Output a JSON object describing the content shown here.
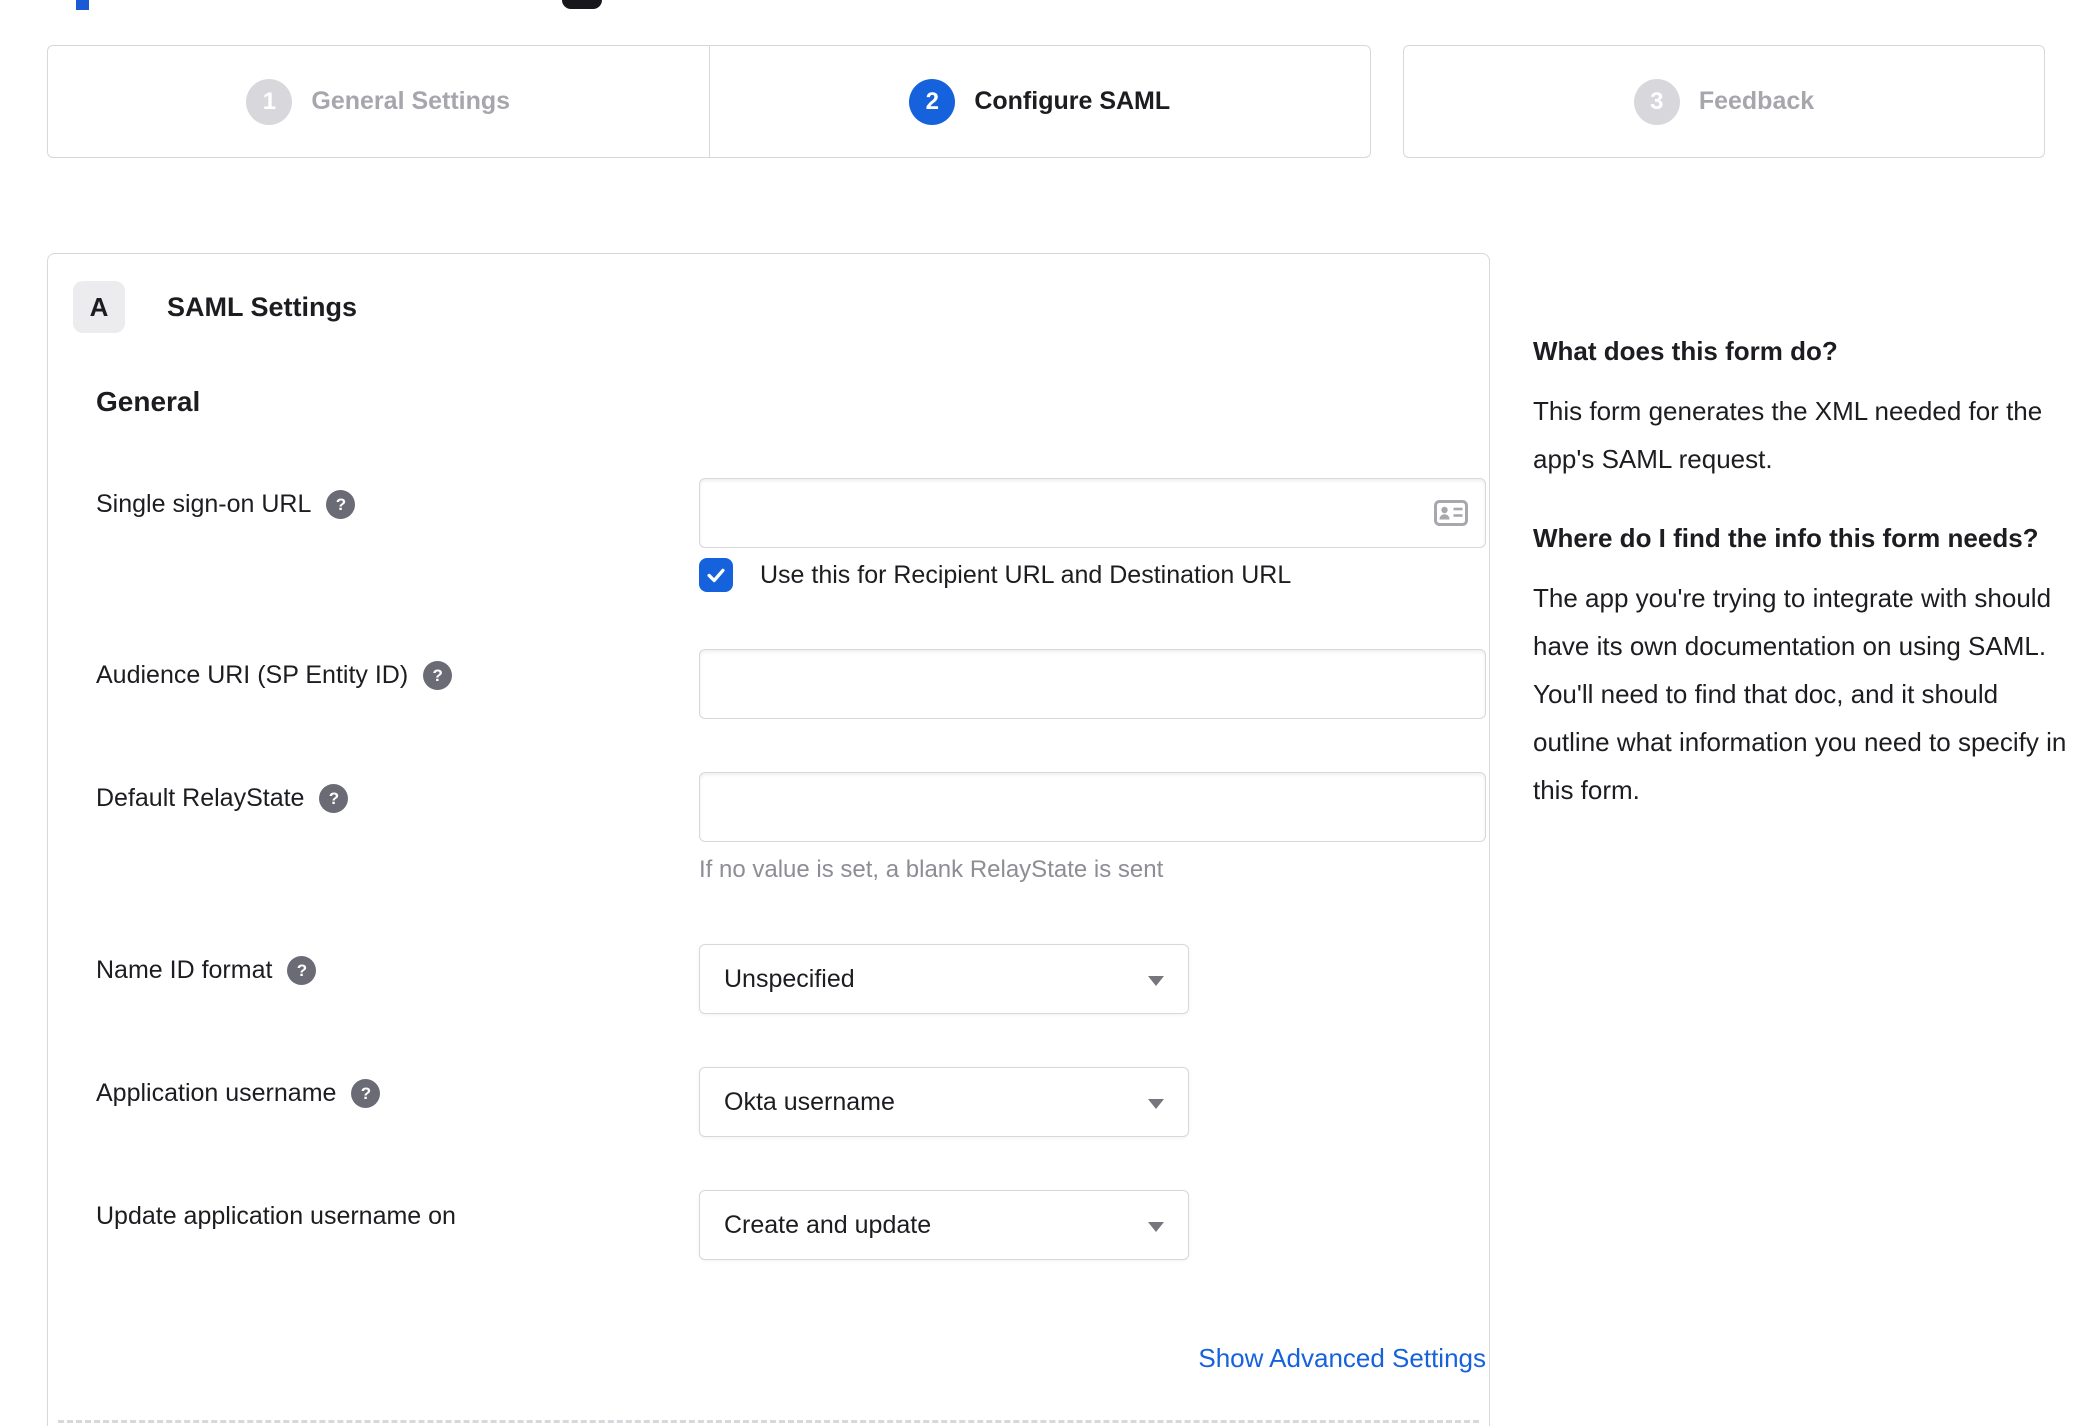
{
  "colors": {
    "accent_blue": "#1662dd",
    "border_grey": "#d8d8dc",
    "text_dark": "#1d1d21",
    "inactive_grey": "#a6a6ad",
    "hint_grey": "#8d8d95",
    "help_icon_bg": "#6b6b75"
  },
  "stepper": {
    "steps": [
      {
        "number": "1",
        "label": "General Settings",
        "state": "inactive"
      },
      {
        "number": "2",
        "label": "Configure SAML",
        "state": "active"
      },
      {
        "number": "3",
        "label": "Feedback",
        "state": "inactive"
      }
    ]
  },
  "panel": {
    "badge": "A",
    "title": "SAML Settings",
    "section_heading": "General",
    "help_glyph": "?",
    "rows": [
      {
        "label": "Single sign-on URL",
        "value": "",
        "checkbox_label": "Use this for Recipient URL and Destination URL",
        "checkbox_checked": true
      },
      {
        "label": "Audience URI (SP Entity ID)",
        "value": ""
      },
      {
        "label": "Default RelayState",
        "value": "",
        "hint": "If no value is set, a blank RelayState is sent"
      },
      {
        "label": "Name ID format",
        "value": "Unspecified"
      },
      {
        "label": "Application username",
        "value": "Okta username"
      },
      {
        "label": "Update application username on",
        "value": "Create and update"
      }
    ],
    "advanced_link": "Show Advanced Settings"
  },
  "sidebar": {
    "sections": [
      {
        "heading": "What does this form do?",
        "body": "This form generates the XML needed for the app's SAML request."
      },
      {
        "heading": "Where do I find the info this form needs?",
        "body": "The app you're trying to integrate with should have its own documentation on using SAML. You'll need to find that doc, and it should outline what information you need to specify in this form."
      }
    ]
  }
}
